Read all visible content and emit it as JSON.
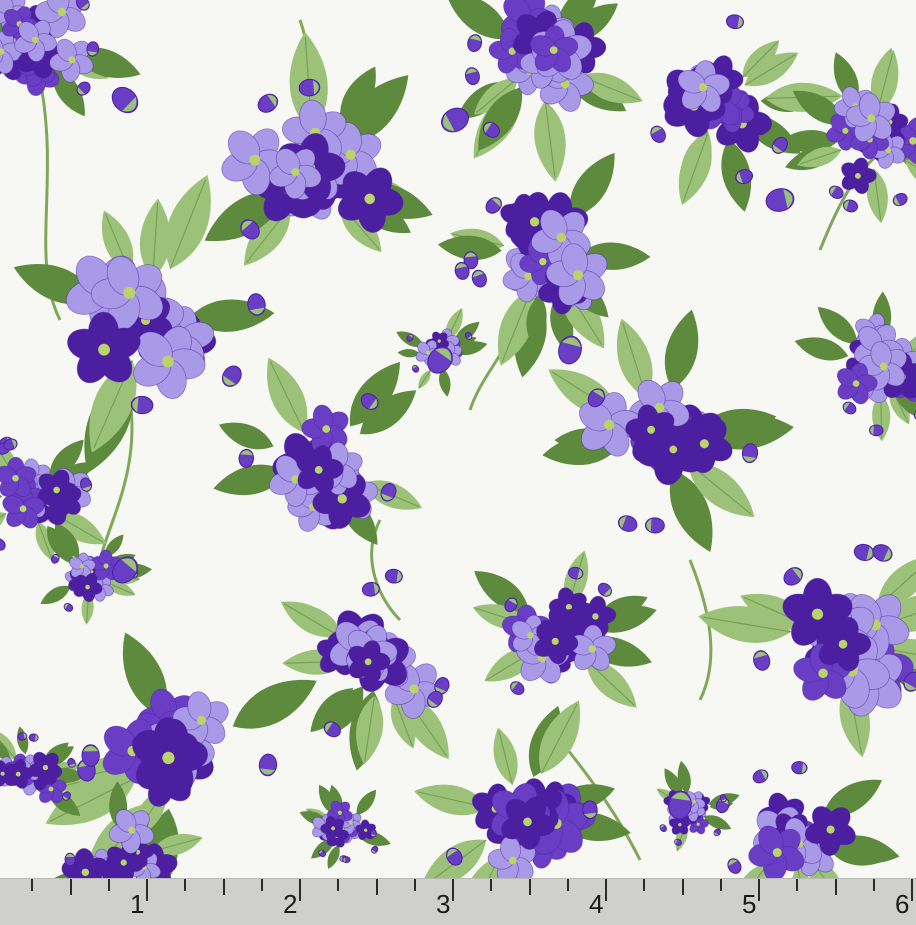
{
  "image": {
    "subject": "floral-fabric-swatch",
    "colors": {
      "background": "#f7f7f3",
      "flower_dark": "#4b1fa0",
      "flower_mid": "#6a3ec4",
      "flower_light": "#a99ae8",
      "flower_center": "#b8d46a",
      "leaf_dark": "#5d8a3c",
      "leaf_light": "#9cc27a",
      "stem": "#7fa85a"
    }
  },
  "ruler": {
    "unit": "inch",
    "labels": [
      "1",
      "2",
      "3",
      "4",
      "5",
      "6"
    ]
  }
}
